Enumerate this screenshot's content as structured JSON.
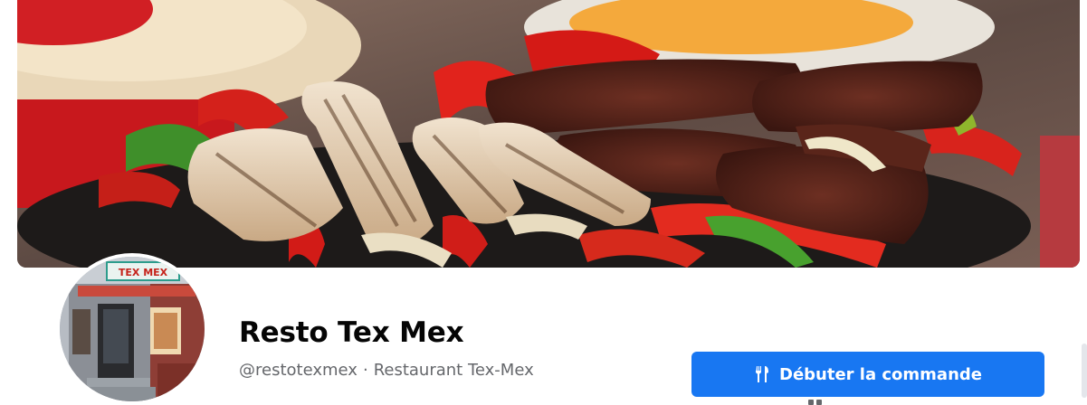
{
  "profile": {
    "name": "Resto Tex Mex",
    "username": "@restotexmex",
    "separator": "·",
    "category": "Restaurant Tex-Mex",
    "storefront_sign": "TEX MEX"
  },
  "actions": {
    "primary_label": "Débuter la commande",
    "primary_icon": "fork-knife-icon"
  },
  "colors": {
    "accent": "#1877f2",
    "name_text": "#050505",
    "meta_text": "#65676b"
  }
}
